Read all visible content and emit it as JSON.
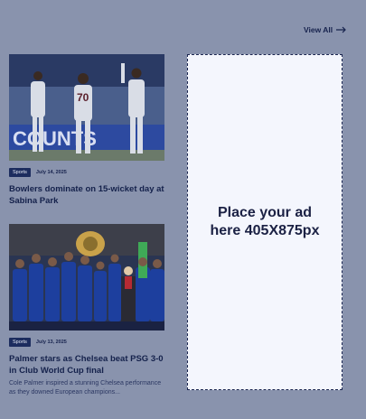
{
  "header": {
    "view_all_label": "View All"
  },
  "articles": [
    {
      "category": "Sports",
      "date": "July 14, 2025",
      "title": "Bowlers dominate on 15-wicket day at Sabina Park",
      "excerpt": "",
      "image_banner_text": "COUNTS",
      "jersey_number": "70"
    },
    {
      "category": "Sports",
      "date": "July 13, 2025",
      "title": "Palmer stars as Chelsea beat PSG 3-0 in Club World Cup final",
      "excerpt": "Cole Palmer inspired a stunning Chelsea performance as they downed European champions..."
    }
  ],
  "ad": {
    "text": "Place your ad here 405X875px"
  },
  "colors": {
    "overlay": "#8993ad",
    "tag_bg": "#1c2c5e",
    "ad_bg": "#f4f6fd",
    "text": "#14214b"
  }
}
